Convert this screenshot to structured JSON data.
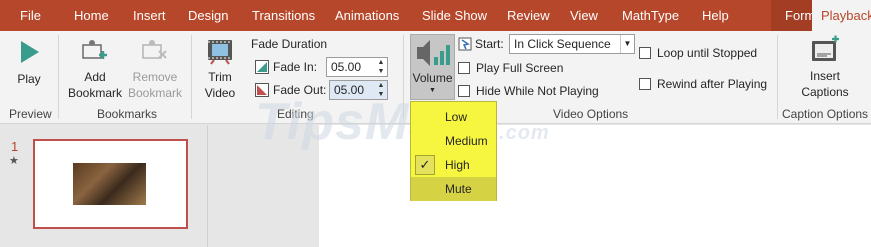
{
  "tabs": [
    "File",
    "Home",
    "Insert",
    "Design",
    "Transitions",
    "Animations",
    "Slide Show",
    "Review",
    "View",
    "MathType",
    "Help",
    "Format",
    "Playback"
  ],
  "active_tab": "Playback",
  "groups": {
    "preview": {
      "label": "Preview",
      "play": "Play"
    },
    "bookmarks": {
      "label": "Bookmarks",
      "add": "Add\nBookmark",
      "remove": "Remove\nBookmark"
    },
    "editing": {
      "label": "Editing",
      "trim": "Trim\nVideo",
      "fade_duration": "Fade Duration",
      "fade_in_label": "Fade In:",
      "fade_in_value": "05.00",
      "fade_out_label": "Fade Out:",
      "fade_out_value": "05.00"
    },
    "video_options": {
      "label": "Video Options",
      "volume": "Volume",
      "start_label": "Start:",
      "start_value": "In Click Sequence",
      "play_full_screen": "Play Full Screen",
      "hide_while_not_playing": "Hide While Not Playing",
      "loop_until_stopped": "Loop until Stopped",
      "rewind_after_playing": "Rewind after Playing"
    },
    "caption_options": {
      "label": "Caption Options",
      "insert_captions": "Insert\nCaptions"
    }
  },
  "volume_menu": {
    "items": [
      "Low",
      "Medium",
      "High",
      "Mute"
    ],
    "checked": "High",
    "hovered": "Mute"
  },
  "slides": {
    "number": "1",
    "star": "★"
  },
  "watermark": {
    "main": "TipsMake",
    "suffix": ".com"
  },
  "colors": {
    "accent": "#b7472a",
    "menu_bg": "#f6f53f"
  }
}
